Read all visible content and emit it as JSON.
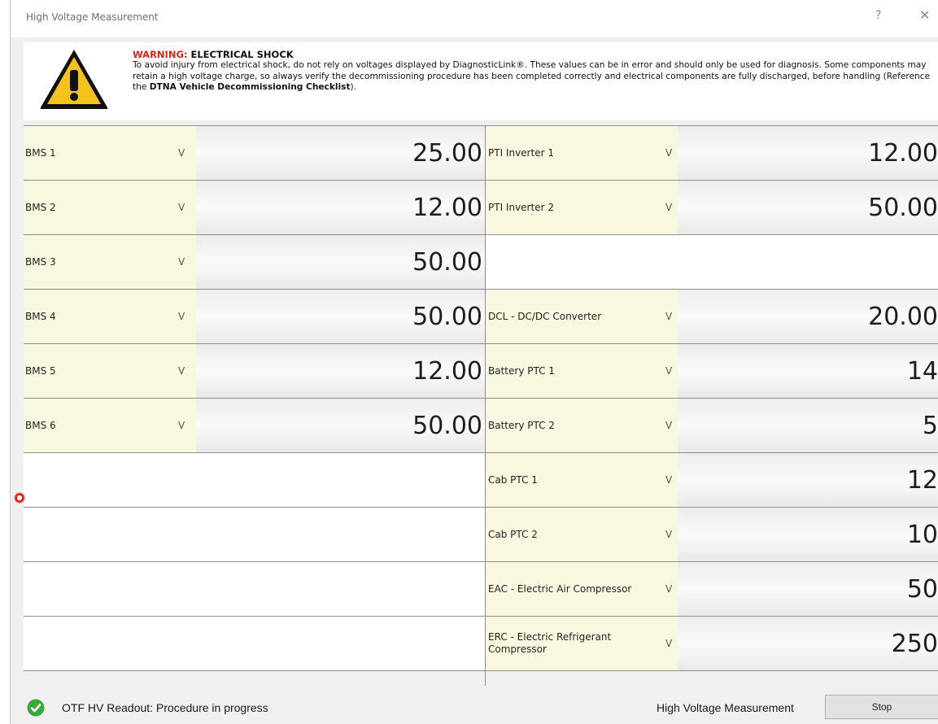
{
  "window": {
    "title": "High Voltage Measurement",
    "help_glyph": "?",
    "close_glyph": "✕"
  },
  "warning": {
    "icon": "warning-triangle-icon",
    "title_prefix": "WARNING:",
    "title_rest": " ELECTRICAL SHOCK",
    "text_part1": "To avoid injury from electrical shock, do not rely on voltages displayed by DiagnosticLink®. These values can be in error and should only be used for diagnosis. Some components may retain a high voltage charge, so always verify the decommissioning procedure has been completed correctly and electrical components are fully discharged, before handling (Reference the ",
    "text_bold": "DTNA Vehicle Decommissioning Checklist",
    "text_end": ")."
  },
  "measurements": {
    "left": [
      {
        "name": "BMS 1",
        "unit": "V",
        "value": "25.00"
      },
      {
        "name": "BMS 2",
        "unit": "V",
        "value": "12.00"
      },
      {
        "name": "BMS 3",
        "unit": "V",
        "value": "50.00"
      },
      {
        "name": "BMS 4",
        "unit": "V",
        "value": "50.00"
      },
      {
        "name": "BMS 5",
        "unit": "V",
        "value": "12.00"
      },
      {
        "name": "BMS 6",
        "unit": "V",
        "value": "50.00"
      }
    ],
    "right": [
      {
        "name": "PTI Inverter 1",
        "unit": "V",
        "value": "12.00"
      },
      {
        "name": "PTI Inverter 2",
        "unit": "V",
        "value": "50.00"
      },
      {
        "name": "DCL - DC/DC Converter",
        "unit": "V",
        "value": "20.00"
      },
      {
        "name": "Battery PTC 1",
        "unit": "V",
        "value": "14"
      },
      {
        "name": "Battery PTC 2",
        "unit": "V",
        "value": "5"
      },
      {
        "name": "Cab PTC 1",
        "unit": "V",
        "value": "12"
      },
      {
        "name": "Cab PTC 2",
        "unit": "V",
        "value": "10"
      },
      {
        "name": "EAC - Electric Air Compressor",
        "unit": "V",
        "value": "50"
      },
      {
        "name": "ERC - Electric Refrigerant Compressor",
        "unit": "V",
        "value": "250"
      }
    ]
  },
  "status": {
    "icon": "check-circle-icon",
    "color": "#3aa83a",
    "text": "OTF HV Readout: Procedure in progress",
    "label": "High Voltage Measurement",
    "stop_label": "Stop"
  }
}
